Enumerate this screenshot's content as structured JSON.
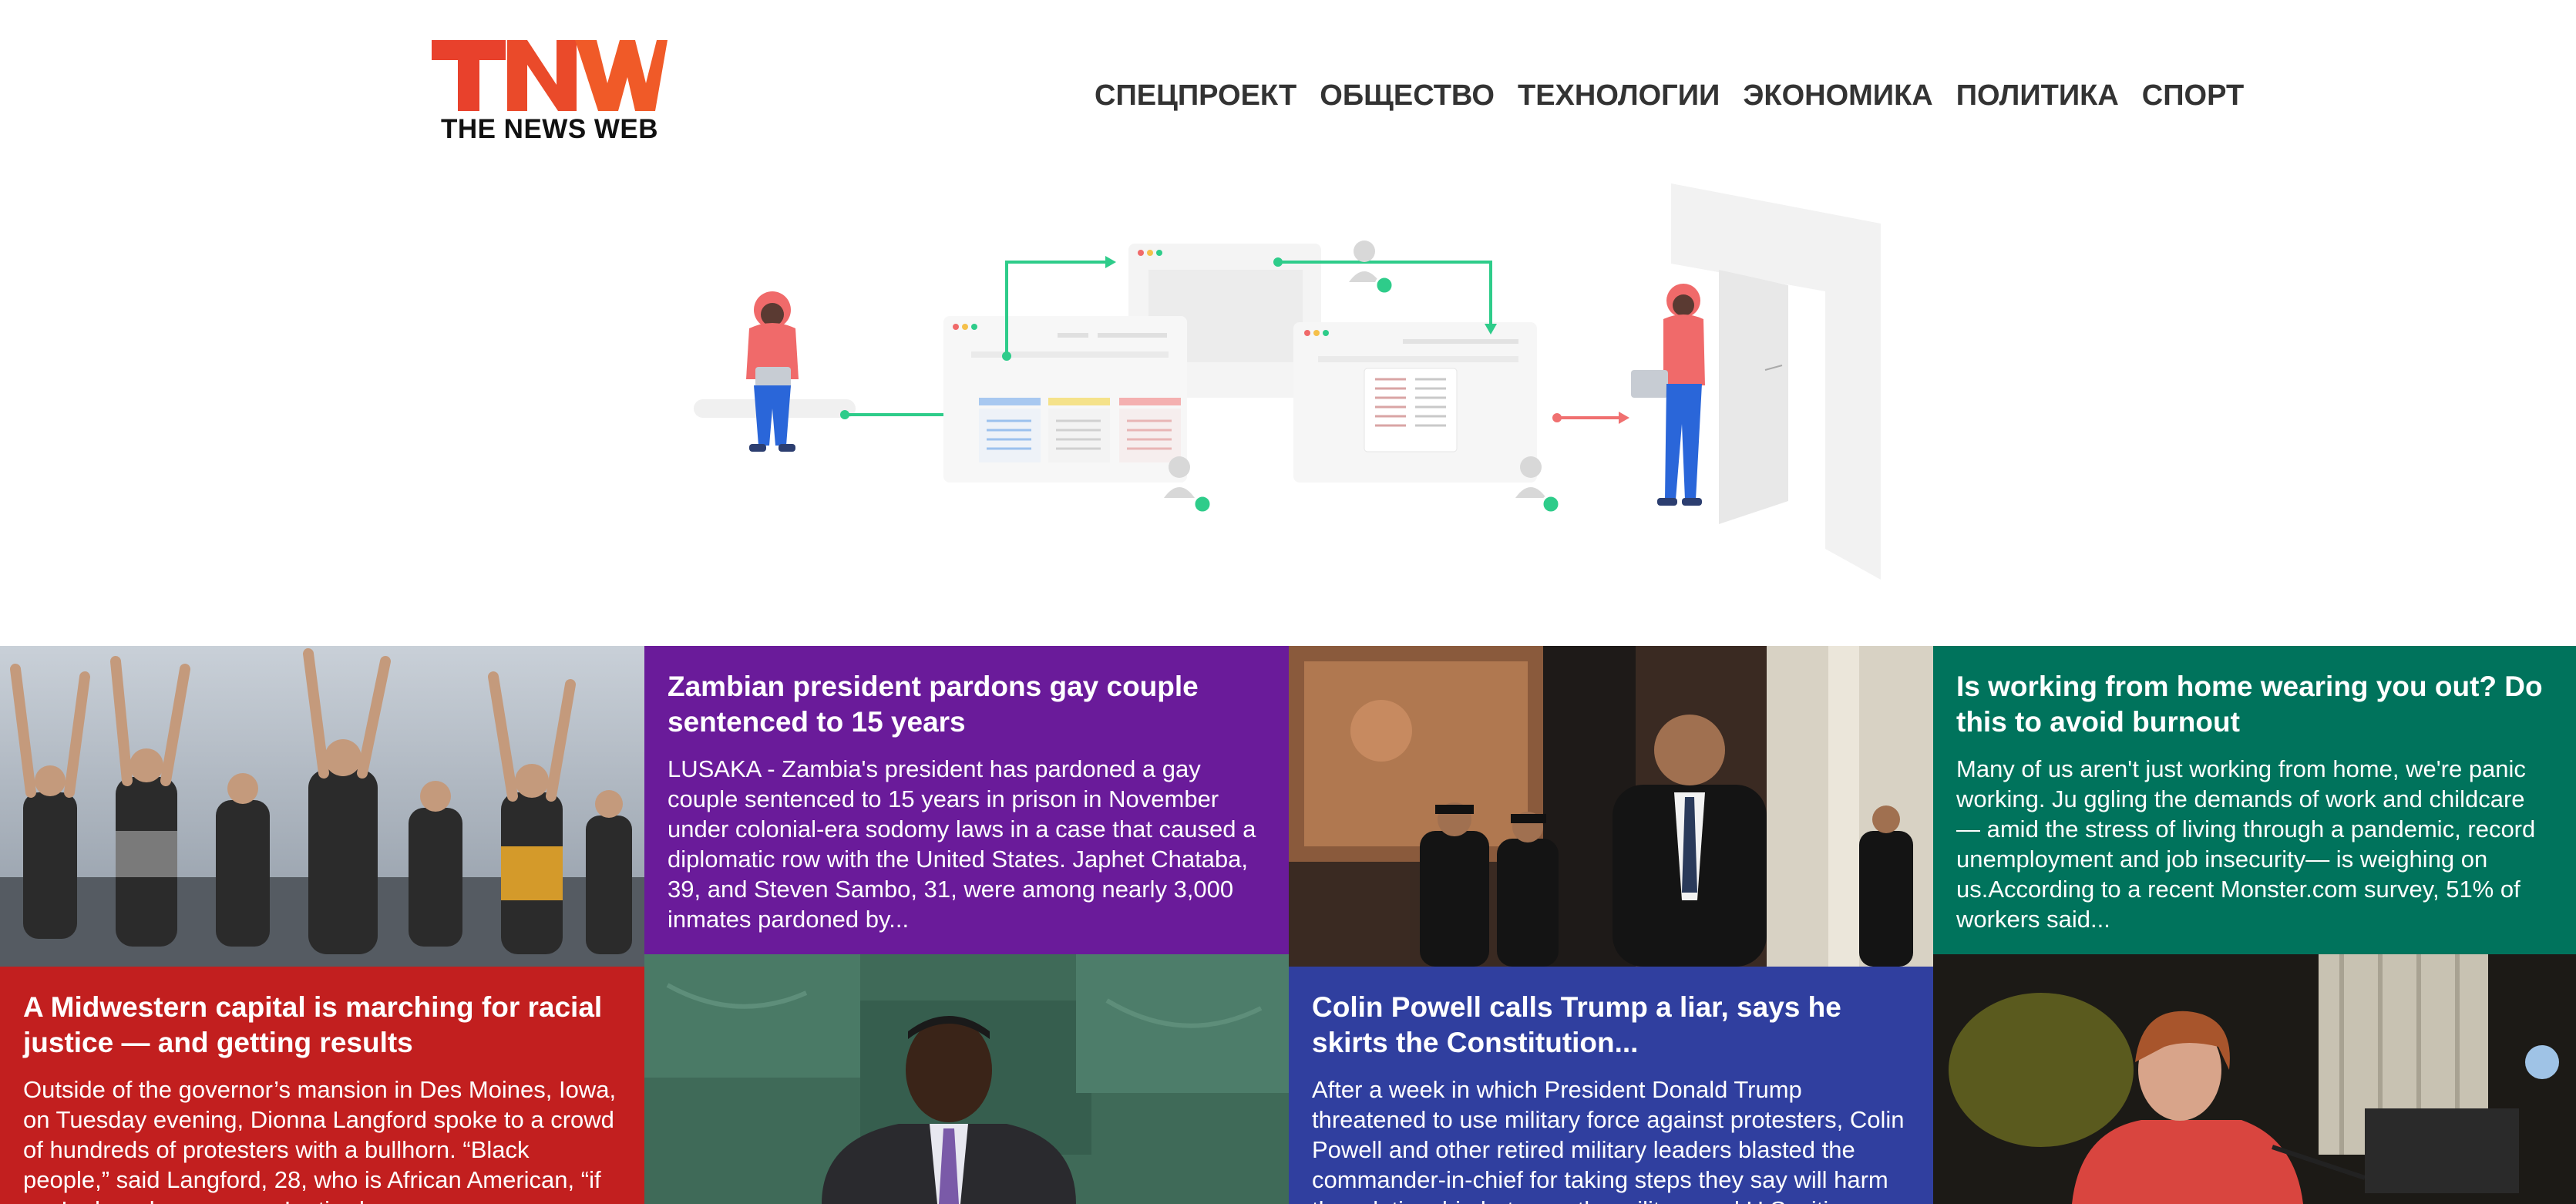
{
  "brand": {
    "logo_letters": "TNW",
    "tagline": "THE NEWS WEB",
    "colors": {
      "logo_red": "#e8412c",
      "logo_orange": "#f05a28"
    }
  },
  "nav": {
    "items": [
      {
        "label": "СПЕЦПРОЕКТ"
      },
      {
        "label": "ОБЩЕСТВО"
      },
      {
        "label": "ТЕХНОЛОГИИ"
      },
      {
        "label": "ЭКОНОМИКА"
      },
      {
        "label": "ПОЛИТИКА"
      },
      {
        "label": "СПОРТ"
      }
    ]
  },
  "hero": {
    "illustration": "remote-collaboration-workflow",
    "colors": {
      "accent_green": "#2ecc8a",
      "accent_red": "#f07070",
      "person_jacket": "#f06a6a",
      "person_pants": "#2a66d9"
    }
  },
  "articles": [
    {
      "title": "Zambian president pardons gay couple sentenced to 15 years",
      "excerpt": "LUSAKA - Zambia's president has pardoned a gay couple sentenced to 15 years in prison in November under colonial-era sodomy laws in a case that caused a diplomatic row with the United States. Japhet Chataba, 39, and Steven Sambo, 31, were among nearly 3,000 inmates pardoned by...",
      "color": "#6a1b9a",
      "image": "man-in-suit-at-podium-photo"
    },
    {
      "title": "Is working from home wearing you out? Do this to avoid burnout",
      "excerpt": "Many of us aren't just working from home, we're panic working. Ju ggling the demands of work and childcare — amid the stress of living through a pandemic, record unemployment and job insecurity— is weighing on us.According to a recent Monster.com survey, 51% of workers said...",
      "color": "#00735c",
      "image": "woman-working-at-laptop-photo"
    },
    {
      "title": "A Midwestern capital is marching for racial justice — and getting results",
      "excerpt": "Outside of the governor’s mansion in Des Moines, Iowa, on Tuesday evening, Dionna Langford spoke to a crowd of hundreds of protesters with a bullhorn. “Black people,” said Langford, 28, who is African American, “if you’re here because you’re tired...",
      "color": "#c21f1f",
      "image": "protesters-raising-hands-photo"
    },
    {
      "title": "Colin Powell calls Trump a liar, says he skirts the Constitution...",
      "excerpt": "After a week in which President Donald Trump threatened to use military force against protesters, Colin Powell and other retired military leaders blasted the commander-in-chief for taking steps they say will harm the relationship between the military and U.S. citizens...",
      "color": "#303f9f",
      "image": "colin-powell-with-police-photo"
    }
  ]
}
